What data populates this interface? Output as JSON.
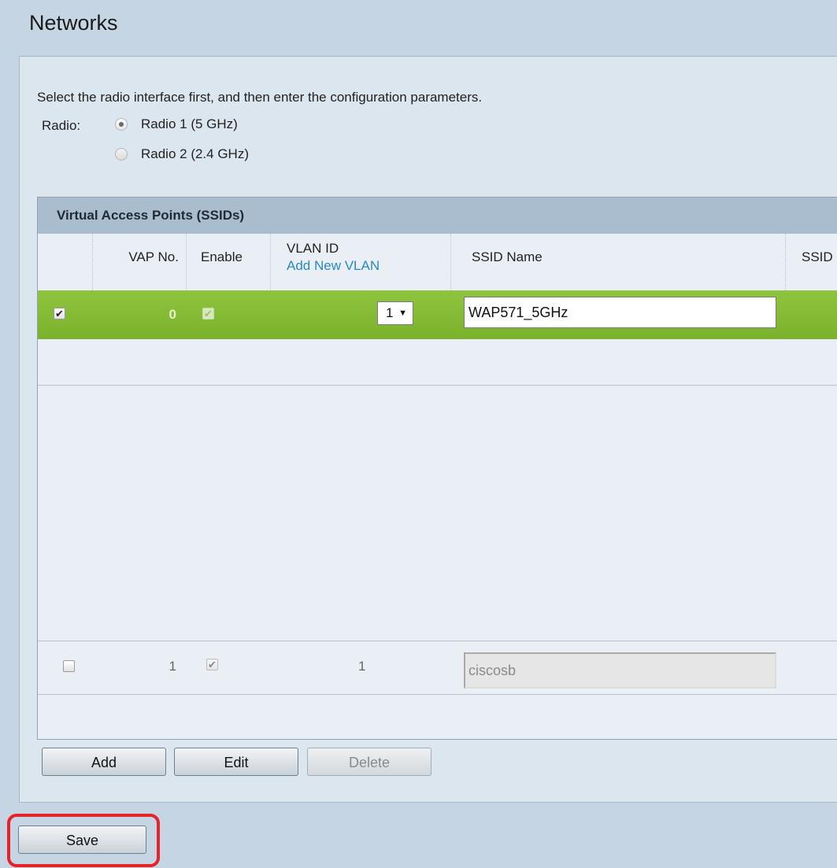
{
  "page": {
    "title": "Networks"
  },
  "instructions": "Select the radio interface first, and then enter the configuration parameters.",
  "radio": {
    "label": "Radio:",
    "options": [
      {
        "label": "Radio 1 (5 GHz)",
        "selected": true
      },
      {
        "label": "Radio 2 (2.4 GHz)",
        "selected": false
      }
    ]
  },
  "vap_table": {
    "title": "Virtual Access Points (SSIDs)",
    "columns": {
      "vap_no": "VAP No.",
      "enable": "Enable",
      "vlan_id": "VLAN ID",
      "add_new_vlan": "Add New VLAN",
      "ssid_name": "SSID Name",
      "ssid_cut": "SSID"
    },
    "rows": [
      {
        "selected": true,
        "vap_no": "0",
        "enabled": true,
        "vlan_id": "1",
        "ssid_name": "WAP571_5GHz",
        "editable": true
      },
      {
        "selected": false,
        "vap_no": "1",
        "enabled": true,
        "vlan_id": "1",
        "ssid_name": "ciscosb",
        "editable": false
      }
    ]
  },
  "buttons": {
    "add": "Add",
    "edit": "Edit",
    "delete": "Delete",
    "save": "Save"
  },
  "colors": {
    "selected_row": "#85b935",
    "highlight": "#e8222a",
    "link": "#2a88c8"
  }
}
